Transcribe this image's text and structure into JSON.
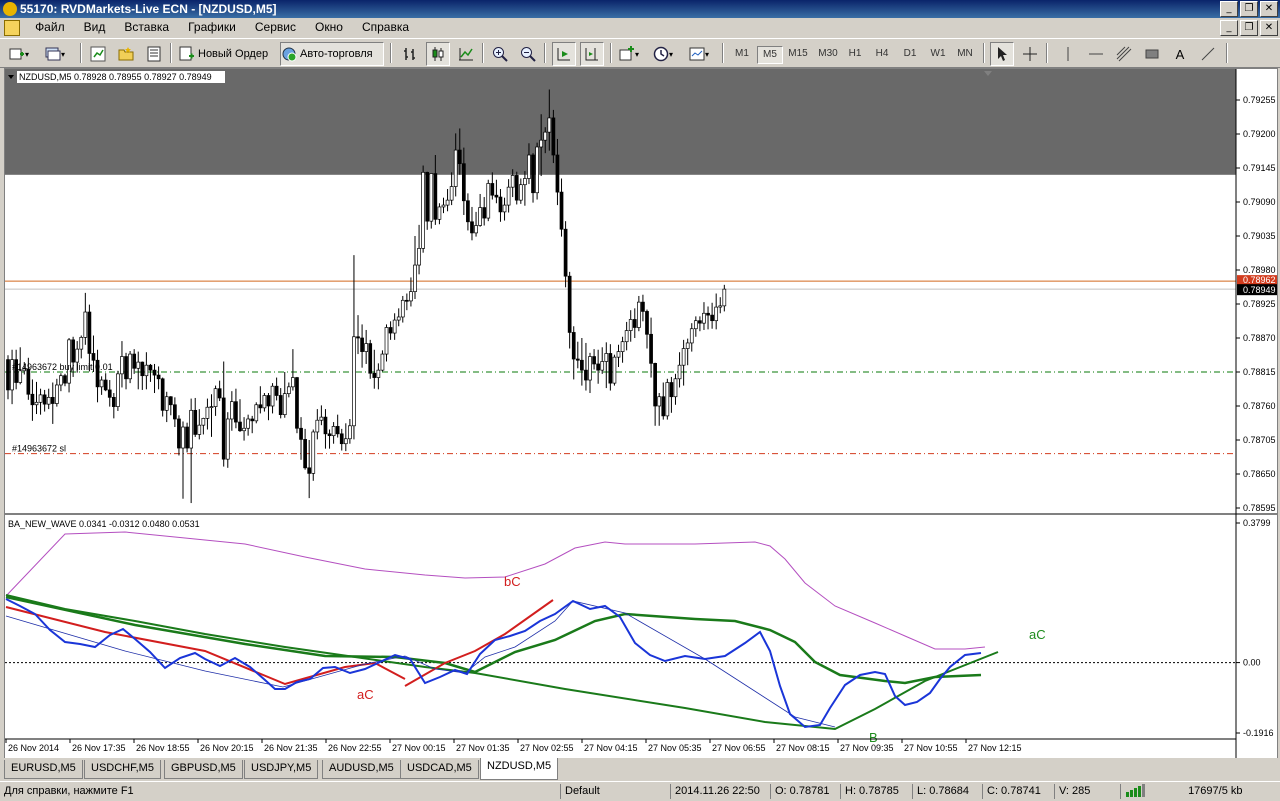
{
  "window": {
    "title": "55170: RVDMarkets-Live ECN - [NZDUSD,M5]",
    "minimize": "_",
    "restore": "❐",
    "close": "✕"
  },
  "menu": [
    "Файл",
    "Вид",
    "Вставка",
    "Графики",
    "Сервис",
    "Окно",
    "Справка"
  ],
  "toolbar": {
    "new_order": "Новый Ордер",
    "auto_trading": "Авто-торговля",
    "timeframes": [
      "M1",
      "M5",
      "M15",
      "M30",
      "H1",
      "H4",
      "D1",
      "W1",
      "MN"
    ],
    "active_timeframe": "M5",
    "text_tool": "A"
  },
  "chart": {
    "symbol_info": "NZDUSD,M5  0.78928 0.78955 0.78927 0.78949",
    "price_ticks": [
      "0.79255",
      "0.79200",
      "0.79145",
      "0.79090",
      "0.79035",
      "0.78980",
      "0.78925",
      "0.78870",
      "0.78815",
      "0.78760",
      "0.78705",
      "0.78650",
      "0.78595"
    ],
    "price_range": [
      0.78595,
      0.79255
    ],
    "current_price": "0.78949",
    "resistance_price": "0.78962",
    "order_buy_label": "#14963672 buy limit 0.01",
    "order_buy_price": 0.78815,
    "order_sl_label": "#14963672 sl",
    "order_sl_price": 0.78683,
    "zone_top_price": 0.79255,
    "zone_bottom_price": 0.79134,
    "candles_key": "candles",
    "colors": {
      "bull": "#ffffff",
      "bear": "#000000",
      "zone": "#696969",
      "buyline": "#0a7a0a",
      "slline": "#d23c1e",
      "resline": "#d2691e",
      "price_tag": "#d23c1e"
    }
  },
  "indicator": {
    "label": "BA_NEW_WAVE 0.0341 -0.0312 0.0480 0.0531",
    "ticks": [
      "0.3799",
      "0.00",
      "-0.1916"
    ],
    "range": [
      -0.1916,
      0.3799
    ],
    "wave_labels": [
      {
        "text": "bC",
        "color": "#d21e1e"
      },
      {
        "text": "aC",
        "color": "#d21e1e"
      },
      {
        "text": "aC",
        "color": "#1e8c1e"
      },
      {
        "text": "B",
        "color": "#1e8c1e"
      }
    ]
  },
  "time_axis": [
    "26 Nov 2014",
    "26 Nov 17:35",
    "26 Nov 18:55",
    "26 Nov 20:15",
    "26 Nov 21:35",
    "26 Nov 22:55",
    "27 Nov 00:15",
    "27 Nov 01:35",
    "27 Nov 02:55",
    "27 Nov 04:15",
    "27 Nov 05:35",
    "27 Nov 06:55",
    "27 Nov 08:15",
    "27 Nov 09:35",
    "27 Nov 10:55",
    "27 Nov 12:15"
  ],
  "candles": [
    [
      0.78835,
      0.78842,
      0.78771,
      0.78786
    ],
    [
      0.78786,
      0.78851,
      0.78763,
      0.78835
    ],
    [
      0.78835,
      0.78851,
      0.78787,
      0.78798
    ],
    [
      0.78798,
      0.78855,
      0.78795,
      0.78817
    ],
    [
      0.78817,
      0.78831,
      0.78811,
      0.7882
    ],
    [
      0.7882,
      0.78838,
      0.7877,
      0.78779
    ],
    [
      0.78779,
      0.78803,
      0.78736,
      0.78762
    ],
    [
      0.78762,
      0.78799,
      0.78747,
      0.78766
    ],
    [
      0.78766,
      0.78788,
      0.78746,
      0.78778
    ],
    [
      0.78778,
      0.78786,
      0.78751,
      0.78763
    ],
    [
      0.78763,
      0.78788,
      0.78755,
      0.78774
    ],
    [
      0.78774,
      0.78798,
      0.78731,
      0.78764
    ],
    [
      0.78764,
      0.78804,
      0.78759,
      0.78794
    ],
    [
      0.78794,
      0.78813,
      0.78784,
      0.78809
    ],
    [
      0.78809,
      0.78812,
      0.78792,
      0.78797
    ],
    [
      0.78797,
      0.7887,
      0.78782,
      0.78867
    ],
    [
      0.78867,
      0.78872,
      0.78807,
      0.78831
    ],
    [
      0.78831,
      0.78865,
      0.78814,
      0.78852
    ],
    [
      0.78852,
      0.78874,
      0.78837,
      0.78871
    ],
    [
      0.78871,
      0.78943,
      0.78859,
      0.78912
    ],
    [
      0.78912,
      0.78924,
      0.78816,
      0.78845
    ],
    [
      0.78845,
      0.78874,
      0.78815,
      0.78834
    ],
    [
      0.78834,
      0.78851,
      0.78766,
      0.78791
    ],
    [
      0.78791,
      0.78808,
      0.78778,
      0.78802
    ],
    [
      0.78802,
      0.78813,
      0.78784,
      0.78786
    ],
    [
      0.78786,
      0.78802,
      0.78759,
      0.78774
    ],
    [
      0.78774,
      0.78781,
      0.7874,
      0.78759
    ],
    [
      0.78759,
      0.78817,
      0.78752,
      0.78812
    ],
    [
      0.78812,
      0.78865,
      0.7879,
      0.7884
    ],
    [
      0.7884,
      0.78846,
      0.78787,
      0.78804
    ],
    [
      0.78804,
      0.78849,
      0.78797,
      0.78844
    ],
    [
      0.78844,
      0.78852,
      0.78812,
      0.78821
    ],
    [
      0.78821,
      0.78848,
      0.78787,
      0.78831
    ],
    [
      0.78831,
      0.78832,
      0.78786,
      0.78809
    ],
    [
      0.78809,
      0.78847,
      0.78787,
      0.78826
    ],
    [
      0.78826,
      0.78828,
      0.78799,
      0.78818
    ],
    [
      0.78818,
      0.78828,
      0.78781,
      0.7881
    ],
    [
      0.7881,
      0.78824,
      0.78787,
      0.78804
    ],
    [
      0.78804,
      0.78806,
      0.78743,
      0.78753
    ],
    [
      0.78753,
      0.78783,
      0.78734,
      0.78775
    ],
    [
      0.78775,
      0.78776,
      0.78745,
      0.78762
    ],
    [
      0.78762,
      0.78774,
      0.78726,
      0.78739
    ],
    [
      0.78739,
      0.78745,
      0.7868,
      0.78692
    ],
    [
      0.78692,
      0.78735,
      0.7861,
      0.78726
    ],
    [
      0.78726,
      0.78733,
      0.78685,
      0.78692
    ],
    [
      0.78692,
      0.78772,
      0.78603,
      0.78753
    ],
    [
      0.78753,
      0.78773,
      0.7871,
      0.78714
    ],
    [
      0.78714,
      0.78755,
      0.78706,
      0.78729
    ],
    [
      0.78729,
      0.78741,
      0.78714,
      0.7874
    ],
    [
      0.7874,
      0.78772,
      0.78722,
      0.78758
    ],
    [
      0.78758,
      0.78779,
      0.7871,
      0.78759
    ],
    [
      0.78759,
      0.78793,
      0.78744,
      0.78788
    ],
    [
      0.78788,
      0.78801,
      0.78768,
      0.78773
    ],
    [
      0.78773,
      0.78832,
      0.78662,
      0.78674
    ],
    [
      0.78674,
      0.7875,
      0.7866,
      0.78739
    ],
    [
      0.78739,
      0.78784,
      0.7872,
      0.78767
    ],
    [
      0.78767,
      0.78788,
      0.78724,
      0.78734
    ],
    [
      0.78734,
      0.78771,
      0.78718,
      0.7872
    ],
    [
      0.7872,
      0.78742,
      0.78704,
      0.78724
    ],
    [
      0.78724,
      0.78746,
      0.78712,
      0.78739
    ],
    [
      0.78739,
      0.78744,
      0.78716,
      0.78736
    ],
    [
      0.78736,
      0.78766,
      0.78732,
      0.78762
    ],
    [
      0.78762,
      0.78792,
      0.78748,
      0.78757
    ],
    [
      0.78757,
      0.78781,
      0.78751,
      0.78777
    ],
    [
      0.78777,
      0.78781,
      0.78737,
      0.7876
    ],
    [
      0.7876,
      0.78797,
      0.78748,
      0.78792
    ],
    [
      0.78792,
      0.78806,
      0.78769,
      0.78777
    ],
    [
      0.78777,
      0.78789,
      0.7874,
      0.78746
    ],
    [
      0.78746,
      0.78815,
      0.78741,
      0.7878
    ],
    [
      0.7878,
      0.78798,
      0.78774,
      0.78791
    ],
    [
      0.78791,
      0.78852,
      0.78785,
      0.78806
    ],
    [
      0.78806,
      0.78807,
      0.78716,
      0.78724
    ],
    [
      0.78724,
      0.78742,
      0.78673,
      0.78706
    ],
    [
      0.78706,
      0.78723,
      0.78657,
      0.7866
    ],
    [
      0.7866,
      0.78705,
      0.78611,
      0.78651
    ],
    [
      0.78651,
      0.78722,
      0.78639,
      0.78718
    ],
    [
      0.78718,
      0.78755,
      0.78706,
      0.78737
    ],
    [
      0.78737,
      0.78761,
      0.78729,
      0.78742
    ],
    [
      0.78742,
      0.78755,
      0.78691,
      0.78715
    ],
    [
      0.78715,
      0.78722,
      0.78691,
      0.78712
    ],
    [
      0.78712,
      0.78734,
      0.78699,
      0.78727
    ],
    [
      0.78727,
      0.78746,
      0.78709,
      0.78715
    ],
    [
      0.78715,
      0.78723,
      0.78688,
      0.78699
    ],
    [
      0.78699,
      0.78732,
      0.78687,
      0.78707
    ],
    [
      0.78707,
      0.78739,
      0.78699,
      0.78728
    ],
    [
      0.78728,
      0.79004,
      0.78706,
      0.78872
    ],
    [
      0.78872,
      0.78907,
      0.78844,
      0.7887
    ],
    [
      0.7887,
      0.78892,
      0.78822,
      0.78848
    ],
    [
      0.78848,
      0.78883,
      0.78828,
      0.78861
    ],
    [
      0.78861,
      0.78867,
      0.78804,
      0.78813
    ],
    [
      0.78813,
      0.78851,
      0.78788,
      0.78806
    ],
    [
      0.78806,
      0.78829,
      0.78787,
      0.78818
    ],
    [
      0.78818,
      0.7885,
      0.78816,
      0.78844
    ],
    [
      0.78844,
      0.78892,
      0.78832,
      0.78887
    ],
    [
      0.78887,
      0.78897,
      0.78867,
      0.78878
    ],
    [
      0.78878,
      0.7891,
      0.78867,
      0.78899
    ],
    [
      0.78899,
      0.78918,
      0.78889,
      0.78904
    ],
    [
      0.78904,
      0.78938,
      0.78895,
      0.78931
    ],
    [
      0.78931,
      0.78942,
      0.78915,
      0.7893
    ],
    [
      0.7893,
      0.78968,
      0.78921,
      0.78945
    ],
    [
      0.78945,
      0.79035,
      0.78933,
      0.78988
    ],
    [
      0.78988,
      0.79053,
      0.78973,
      0.79015
    ],
    [
      0.79015,
      0.79149,
      0.79008,
      0.79138
    ],
    [
      0.79138,
      0.79139,
      0.79045,
      0.79059
    ],
    [
      0.79059,
      0.79136,
      0.79047,
      0.79136
    ],
    [
      0.79136,
      0.79166,
      0.79053,
      0.79062
    ],
    [
      0.79062,
      0.79088,
      0.79054,
      0.79082
    ],
    [
      0.79082,
      0.79097,
      0.79072,
      0.79085
    ],
    [
      0.79085,
      0.79111,
      0.79075,
      0.79093
    ],
    [
      0.79093,
      0.79138,
      0.79085,
      0.79115
    ],
    [
      0.79115,
      0.79201,
      0.79099,
      0.79174
    ],
    [
      0.79174,
      0.79209,
      0.79134,
      0.79152
    ],
    [
      0.79152,
      0.79178,
      0.79069,
      0.79092
    ],
    [
      0.79092,
      0.79104,
      0.79044,
      0.79058
    ],
    [
      0.79058,
      0.79082,
      0.79028,
      0.7904
    ],
    [
      0.7904,
      0.79074,
      0.79034,
      0.79052
    ],
    [
      0.79052,
      0.79103,
      0.7905,
      0.79081
    ],
    [
      0.79081,
      0.79098,
      0.79052,
      0.79064
    ],
    [
      0.79064,
      0.79126,
      0.79059,
      0.7912
    ],
    [
      0.7912,
      0.79138,
      0.79094,
      0.79101
    ],
    [
      0.79101,
      0.79126,
      0.79088,
      0.79098
    ],
    [
      0.79098,
      0.79111,
      0.79058,
      0.79074
    ],
    [
      0.79074,
      0.79097,
      0.7906,
      0.79085
    ],
    [
      0.79085,
      0.79127,
      0.79073,
      0.79114
    ],
    [
      0.79114,
      0.79143,
      0.79098,
      0.79133
    ],
    [
      0.79133,
      0.79139,
      0.79086,
      0.79093
    ],
    [
      0.79093,
      0.79128,
      0.79087,
      0.79118
    ],
    [
      0.79118,
      0.7914,
      0.79084,
      0.79128
    ],
    [
      0.79128,
      0.79185,
      0.79119,
      0.79166
    ],
    [
      0.79166,
      0.79169,
      0.79089,
      0.79105
    ],
    [
      0.79105,
      0.79186,
      0.79094,
      0.79179
    ],
    [
      0.79179,
      0.79232,
      0.79132,
      0.7919
    ],
    [
      0.7919,
      0.79211,
      0.79169,
      0.79203
    ],
    [
      0.79203,
      0.79272,
      0.79173,
      0.79226
    ],
    [
      0.79226,
      0.79239,
      0.79153,
      0.79166
    ],
    [
      0.79166,
      0.79192,
      0.79085,
      0.79106
    ],
    [
      0.79106,
      0.79128,
      0.79034,
      0.79046
    ],
    [
      0.79046,
      0.79059,
      0.78952,
      0.7897
    ],
    [
      0.7897,
      0.78977,
      0.78853,
      0.78879
    ],
    [
      0.78879,
      0.78889,
      0.78803,
      0.78836
    ],
    [
      0.78836,
      0.78864,
      0.78821,
      0.78834
    ],
    [
      0.78834,
      0.7887,
      0.78793,
      0.78818
    ],
    [
      0.78818,
      0.78862,
      0.78785,
      0.78802
    ],
    [
      0.78802,
      0.78846,
      0.78781,
      0.7884
    ],
    [
      0.7884,
      0.78852,
      0.78819,
      0.78828
    ],
    [
      0.78828,
      0.78851,
      0.78796,
      0.78818
    ],
    [
      0.78818,
      0.78855,
      0.78812,
      0.78832
    ],
    [
      0.78832,
      0.78863,
      0.78789,
      0.78845
    ],
    [
      0.78845,
      0.7886,
      0.78785,
      0.78797
    ],
    [
      0.78797,
      0.78843,
      0.78793,
      0.78839
    ],
    [
      0.78839,
      0.78859,
      0.78823,
      0.78848
    ],
    [
      0.78848,
      0.78872,
      0.7883,
      0.78864
    ],
    [
      0.78864,
      0.78896,
      0.7885,
      0.78882
    ],
    [
      0.78882,
      0.78915,
      0.78864,
      0.789
    ],
    [
      0.789,
      0.78918,
      0.7887,
      0.78887
    ],
    [
      0.78887,
      0.78938,
      0.78881,
      0.78928
    ],
    [
      0.78928,
      0.7894,
      0.78897,
      0.78913
    ],
    [
      0.78913,
      0.78916,
      0.78853,
      0.78876
    ],
    [
      0.78876,
      0.78903,
      0.78806,
      0.78829
    ],
    [
      0.78829,
      0.7883,
      0.78728,
      0.7876
    ],
    [
      0.7876,
      0.78781,
      0.78728,
      0.78775
    ],
    [
      0.78775,
      0.78798,
      0.78738,
      0.78744
    ],
    [
      0.78744,
      0.78804,
      0.78738,
      0.78798
    ],
    [
      0.78798,
      0.78807,
      0.78749,
      0.78775
    ],
    [
      0.78775,
      0.78812,
      0.78762,
      0.78804
    ],
    [
      0.78804,
      0.78847,
      0.7879,
      0.78826
    ],
    [
      0.78826,
      0.78867,
      0.78793,
      0.78853
    ],
    [
      0.78853,
      0.78869,
      0.78826,
      0.78862
    ],
    [
      0.78862,
      0.78894,
      0.78848,
      0.78885
    ],
    [
      0.78885,
      0.78905,
      0.78872,
      0.78898
    ],
    [
      0.78898,
      0.78905,
      0.78881,
      0.78894
    ],
    [
      0.78894,
      0.78928,
      0.78883,
      0.7891
    ],
    [
      0.7891,
      0.78921,
      0.78884,
      0.78907
    ],
    [
      0.78907,
      0.78927,
      0.78885,
      0.78898
    ],
    [
      0.78898,
      0.78942,
      0.78884,
      0.7892
    ],
    [
      0.7892,
      0.78936,
      0.7891,
      0.78922
    ],
    [
      0.78922,
      0.78956,
      0.78913,
      0.78949
    ]
  ],
  "tabs": [
    "EURUSD,M5",
    "USDCHF,M5",
    "GBPUSD,M5",
    "USDJPY,M5",
    "AUDUSD,M5",
    "USDCAD,M5",
    "NZDUSD,M5"
  ],
  "active_tab": "NZDUSD,M5",
  "status": {
    "help": "Для справки, нажмите F1",
    "profile": "Default",
    "datetime": "2014.11.26 22:50",
    "open": "O: 0.78781",
    "high": "H: 0.78785",
    "low": "L: 0.78684",
    "close": "C: 0.78741",
    "volume": "V: 285",
    "traffic": "17697/5 kb"
  }
}
